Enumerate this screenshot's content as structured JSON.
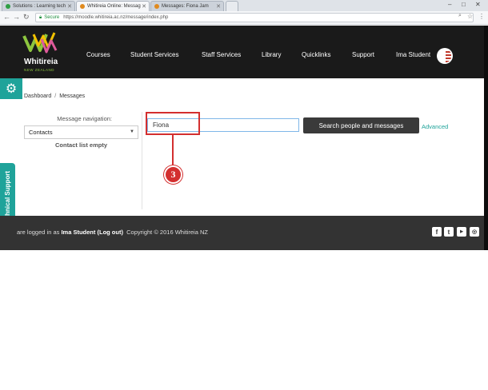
{
  "browser": {
    "tabs": [
      {
        "label": "Solutions : Learning tech",
        "color": "#2e9e44"
      },
      {
        "label": "Whitireia Online: Messag",
        "color": "#e08a1e"
      },
      {
        "label": "Messages: Fiona Jam",
        "color": "#e08a1e"
      }
    ],
    "secure_label": "Secure",
    "url": "https://moodle.whitireia.ac.nz/message/index.php"
  },
  "header": {
    "logo_name": "Whitireia",
    "logo_sub": "NEW ZEALAND",
    "nav": [
      "Courses",
      "Student Services",
      "Staff Services",
      "Library",
      "Quicklinks",
      "Support"
    ],
    "user_name": "Ima Student"
  },
  "breadcrumb": [
    "Dashboard",
    "Messages"
  ],
  "message_nav": {
    "label": "Message navigation:",
    "selected": "Contacts",
    "empty_text": "Contact list empty"
  },
  "search": {
    "value": "Fiona",
    "button_label": "Search people and messages",
    "advanced_label": "Advanced"
  },
  "annotation": {
    "number": "3",
    "color": "#d32f2f"
  },
  "tech_support_label": "Technical Support",
  "footer": {
    "prefix": "are logged in as ",
    "user": "Ima Student",
    "logout": "(Log out)",
    "copyright": "Copyright © 2016 Whitireia NZ",
    "social": [
      "facebook-icon",
      "twitter-icon",
      "youtube-icon",
      "instagram-icon"
    ]
  },
  "colors": {
    "teal": "#1fa39a",
    "header_bg": "#1a1a1a",
    "footer_bg": "#333333",
    "button_bg": "#3a3a3a"
  }
}
